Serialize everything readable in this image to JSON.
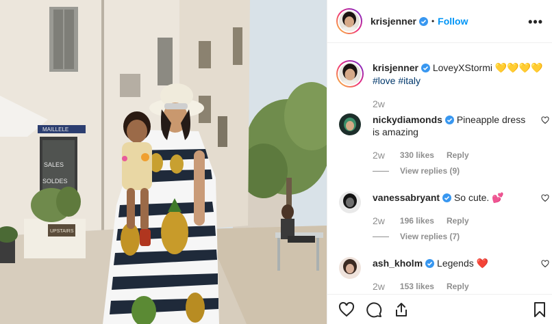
{
  "post": {
    "username": "krisjenner",
    "follow_label": "Follow",
    "separator": "•",
    "more_label": "•••",
    "caption_text": "LoveyXStormi 💛💛💛💛",
    "hashtags": "#love #italy",
    "caption_time": "2w"
  },
  "photo": {
    "shop_sign": "UPSTAIRS",
    "window_text_1": "SALES",
    "window_text_2": "SOLDES",
    "awning_text": "MAILLELE"
  },
  "comments": [
    {
      "username": "nickydiamonds",
      "text": "Pineapple dress is amazing",
      "time": "2w",
      "likes": "330 likes",
      "reply": "Reply",
      "view_replies": "View replies (9)"
    },
    {
      "username": "vanessabryant",
      "text": "So cute. 💕",
      "time": "2w",
      "likes": "196 likes",
      "reply": "Reply",
      "view_replies": "View replies (7)"
    },
    {
      "username": "ash_kholm",
      "text": "Legends ❤️",
      "time": "2w",
      "likes": "153 likes",
      "reply": "Reply"
    }
  ],
  "icons": {
    "verified": "verified-badge-icon",
    "like": "heart-icon",
    "comment": "comment-icon",
    "share": "share-icon",
    "save": "bookmark-icon"
  },
  "colors": {
    "accent": "#0095f6",
    "hashtag": "#00376b",
    "muted": "#8e8e8e",
    "text": "#262626"
  }
}
